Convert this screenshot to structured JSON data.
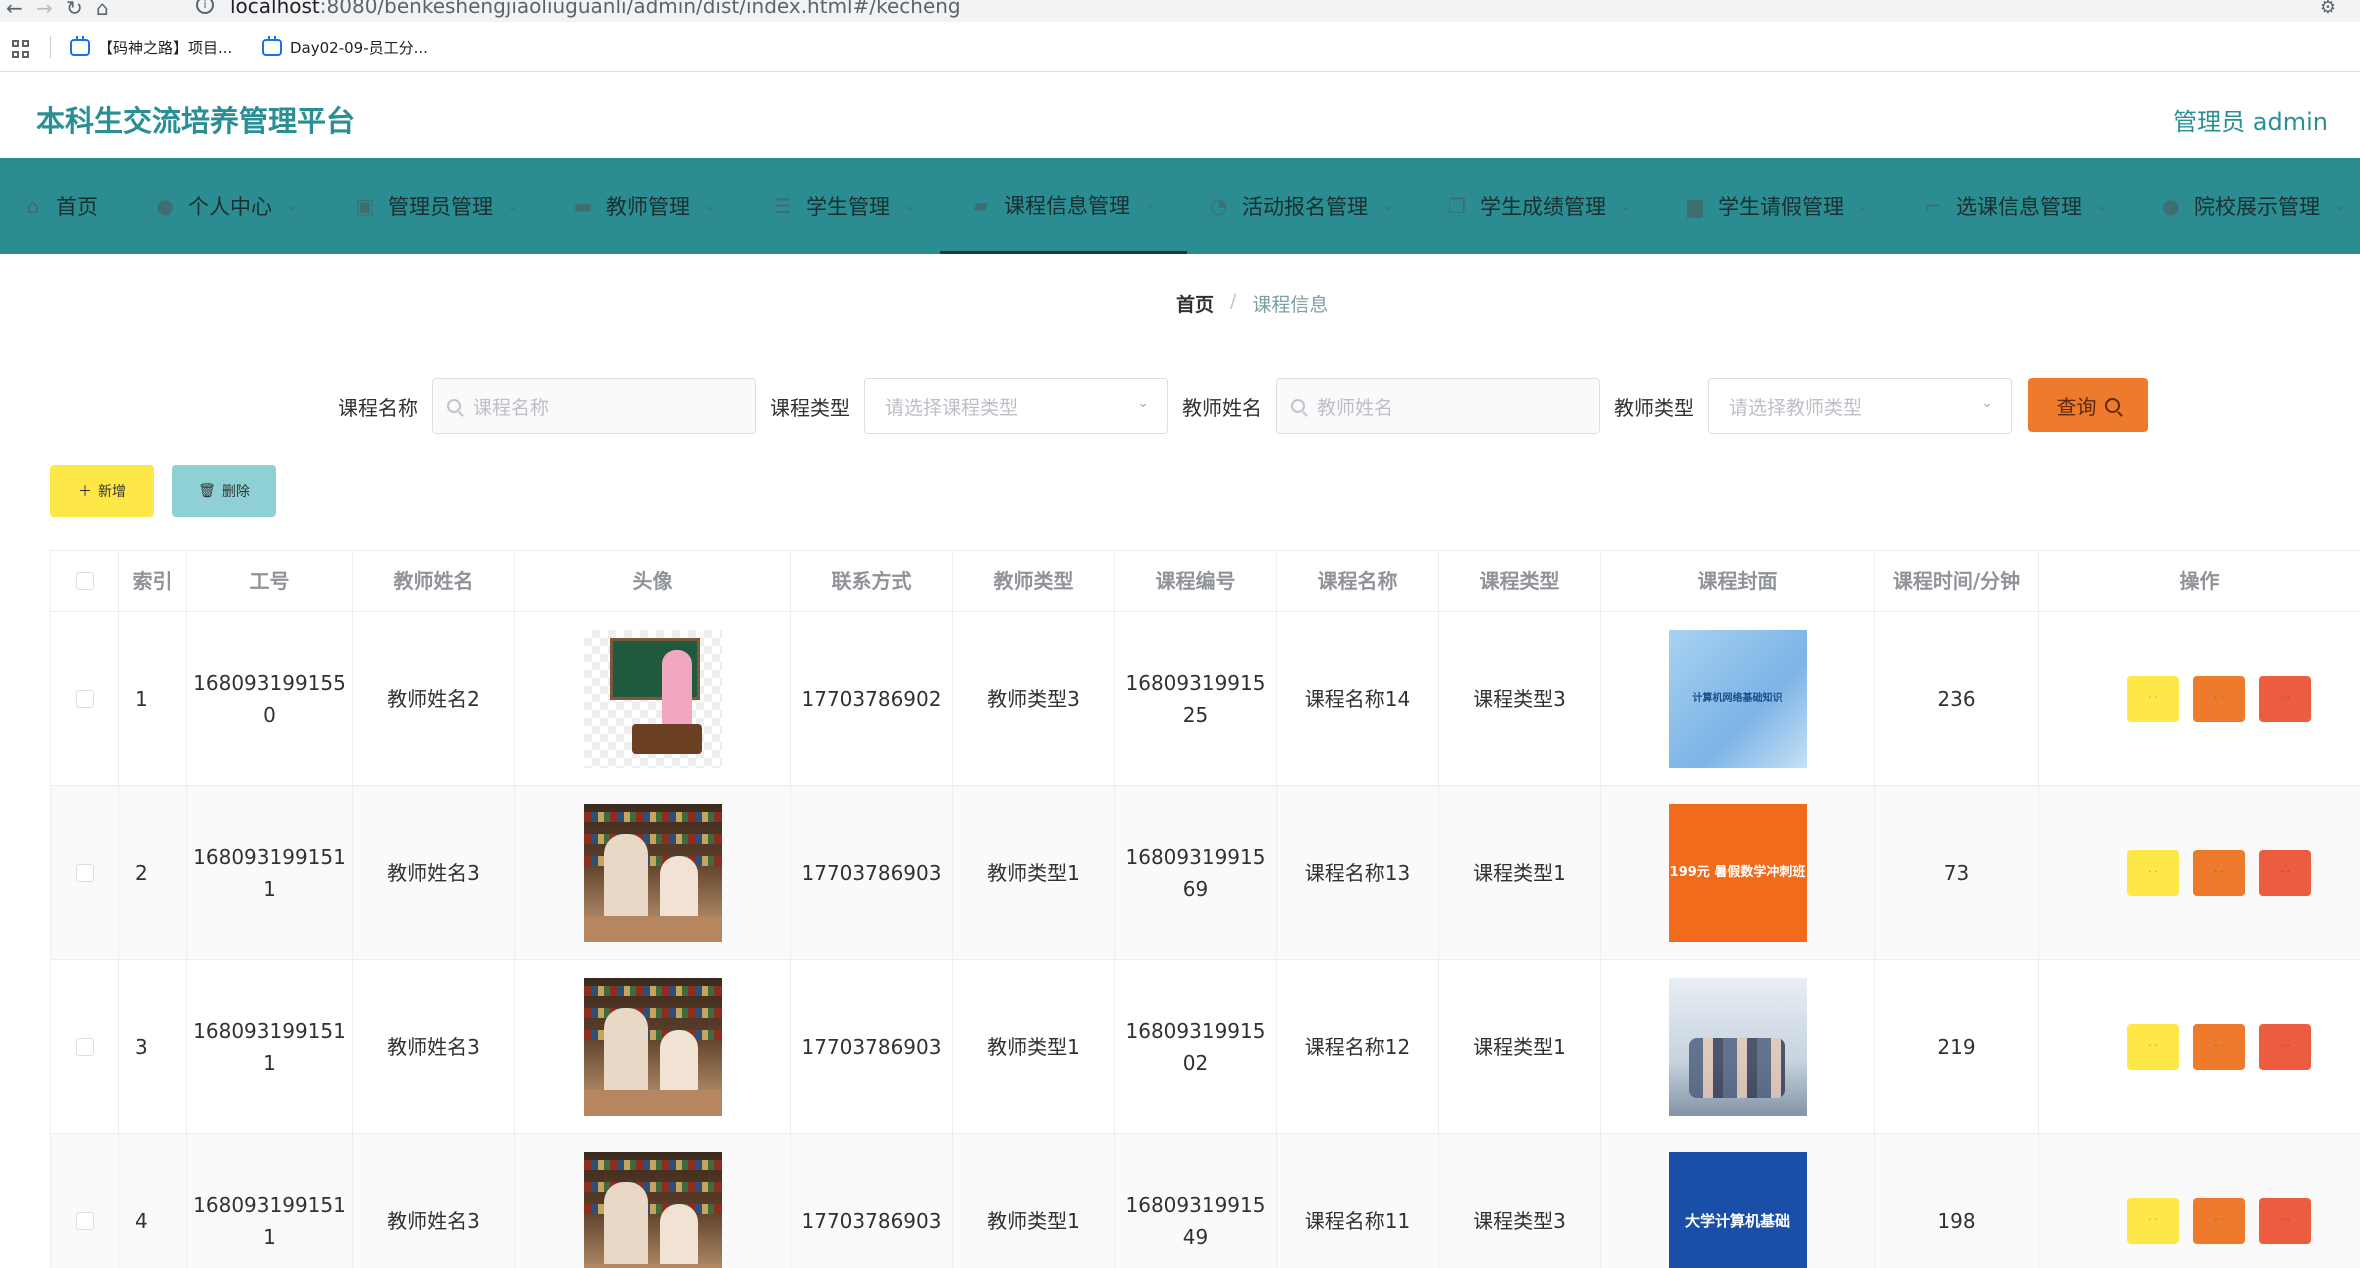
{
  "browser": {
    "url_host": "localhost",
    "url_path": ":8080/benkeshengjiaoliuguanli/admin/dist/index.html#/kecheng",
    "bookmarks": [
      "【码神之路】项目...",
      "Day02-09-员工分..."
    ]
  },
  "header": {
    "title": "本科生交流培养管理平台",
    "user": "管理员 admin"
  },
  "nav": [
    {
      "label": "首页",
      "icon": "home-icon"
    },
    {
      "label": "个人中心",
      "icon": "user-icon"
    },
    {
      "label": "管理员管理",
      "icon": "admin-icon"
    },
    {
      "label": "教师管理",
      "icon": "teacher-icon"
    },
    {
      "label": "学生管理",
      "icon": "student-icon"
    },
    {
      "label": "课程信息管理",
      "icon": "course-icon"
    },
    {
      "label": "活动报名管理",
      "icon": "activity-icon"
    },
    {
      "label": "学生成绩管理",
      "icon": "grade-icon"
    },
    {
      "label": "学生请假管理",
      "icon": "leave-icon"
    },
    {
      "label": "选课信息管理",
      "icon": "select-icon"
    },
    {
      "label": "院校展示管理",
      "icon": "school-icon"
    }
  ],
  "breadcrumb": {
    "home": "首页",
    "current": "课程信息"
  },
  "search": {
    "course_name_label": "课程名称",
    "course_name_placeholder": "课程名称",
    "course_type_label": "课程类型",
    "course_type_placeholder": "请选择课程类型",
    "teacher_name_label": "教师姓名",
    "teacher_name_placeholder": "教师姓名",
    "teacher_type_label": "教师类型",
    "teacher_type_placeholder": "请选择教师类型",
    "query_label": "查询"
  },
  "actions": {
    "add_label": "新增",
    "delete_label": "删除"
  },
  "table": {
    "columns": [
      "索引",
      "工号",
      "教师姓名",
      "头像",
      "联系方式",
      "教师类型",
      "课程编号",
      "课程名称",
      "课程类型",
      "课程封面",
      "课程时间/分钟",
      "操作"
    ],
    "rows": [
      {
        "index": "1",
        "job_no_a": "168093199155",
        "job_no_b": "0",
        "teacher": "教师姓名2",
        "avatar": "teacher-at-blackboard",
        "phone": "17703786902",
        "teacher_type": "教师类型3",
        "course_no_a": "16809319915",
        "course_no_b": "25",
        "course_name": "课程名称14",
        "course_type": "课程类型3",
        "cover": "计算机网络基础知识",
        "minutes": "236"
      },
      {
        "index": "2",
        "job_no_a": "168093199151",
        "job_no_b": "1",
        "teacher": "教师姓名3",
        "avatar": "teachers-in-library",
        "phone": "17703786903",
        "teacher_type": "教师类型1",
        "course_no_a": "16809319915",
        "course_no_b": "69",
        "course_name": "课程名称13",
        "course_type": "课程类型1",
        "cover": "199元 暑假数学冲刺班",
        "minutes": "73"
      },
      {
        "index": "3",
        "job_no_a": "168093199151",
        "job_no_b": "1",
        "teacher": "教师姓名3",
        "avatar": "teachers-in-library",
        "phone": "17703786903",
        "teacher_type": "教师类型1",
        "course_no_a": "16809319915",
        "course_no_b": "02",
        "course_name": "课程名称12",
        "course_type": "课程类型1",
        "cover": "classroom-photo",
        "minutes": "219"
      },
      {
        "index": "4",
        "job_no_a": "168093199151",
        "job_no_b": "1",
        "teacher": "教师姓名3",
        "avatar": "teachers-in-library",
        "phone": "17703786903",
        "teacher_type": "教师类型1",
        "course_no_a": "16809319915",
        "course_no_b": "49",
        "course_name": "课程名称11",
        "course_type": "课程类型3",
        "cover": "大学计算机基础",
        "minutes": "198"
      }
    ]
  },
  "colors": {
    "primary": "#2b8c91",
    "warning": "#fde847",
    "orange": "#ee7a2c",
    "danger": "#ec5c3e",
    "teal_light": "#8ed0d4"
  }
}
